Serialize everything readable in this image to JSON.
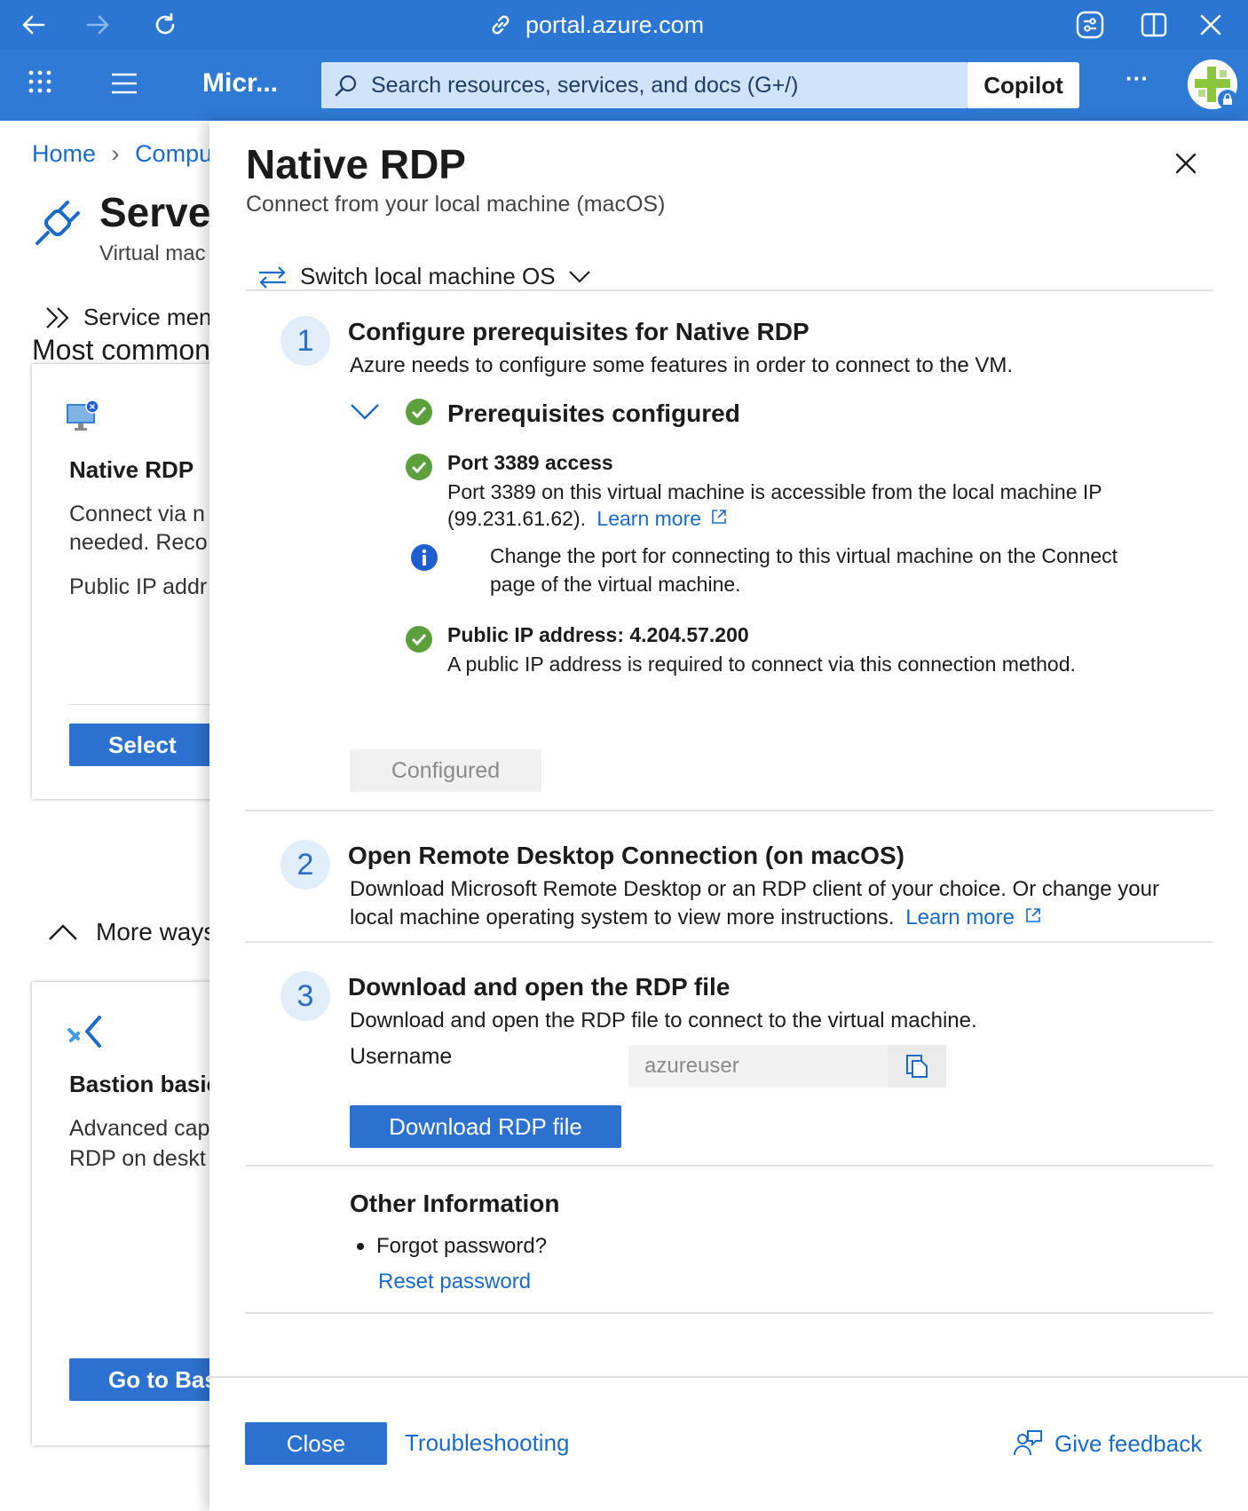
{
  "browser": {
    "url": "portal.azure.com"
  },
  "header": {
    "brand": "Micr...",
    "search_placeholder": "Search resources, services, and docs (G+/)",
    "copilot_label": "Copilot",
    "more_label": "···"
  },
  "background_page": {
    "breadcrumb_home": "Home",
    "breadcrumb_next": "Compu",
    "title": "Serve",
    "subtitle": "Virtual mac",
    "service_menu": "Service men",
    "section_heading": "Most common",
    "native_card": {
      "title": "Native RDP",
      "line1": "Connect via n",
      "line2": "needed. Reco",
      "line3": "Public IP addr",
      "button": "Select"
    },
    "more_ways": "More ways",
    "bastion_card": {
      "title": "Bastion basic",
      "line1": "Advanced cap",
      "line2": "RDP on deskt",
      "button": "Go to Bast"
    }
  },
  "panel": {
    "title": "Native RDP",
    "subtitle": "Connect from your local machine (macOS)",
    "switch_os": "Switch local machine OS",
    "step1": {
      "number": "1",
      "title": "Configure prerequisites for Native RDP",
      "description": "Azure needs to configure some features in order to connect to the VM.",
      "prereq_heading": "Prerequisites configured",
      "port": {
        "title": "Port 3389 access",
        "desc_line1": "Port 3389 on this virtual machine is accessible from the local machine IP",
        "desc_line2": "(99.231.61.62).",
        "learn_more": "Learn more"
      },
      "info_line1": "Change the port for connecting to this virtual machine on the Connect",
      "info_line2": "page of the virtual machine.",
      "public_ip": {
        "title": "Public IP address: 4.204.57.200",
        "desc": "A public IP address is required to connect via this connection method."
      },
      "configured_button": "Configured"
    },
    "step2": {
      "number": "2",
      "title": "Open Remote Desktop Connection (on macOS)",
      "desc_line1": "Download Microsoft Remote Desktop or an RDP client of your choice. Or change your",
      "desc_line2": "local machine operating system to view more instructions.",
      "learn_more": "Learn more"
    },
    "step3": {
      "number": "3",
      "title": "Download and open the RDP file",
      "description": "Download and open the RDP file to connect to the virtual machine.",
      "username_label": "Username",
      "username_value": "azureuser",
      "download_button": "Download RDP file"
    },
    "other_info": {
      "heading": "Other Information",
      "bullet": "Forgot password?",
      "reset_link": "Reset password"
    },
    "footer": {
      "close_button": "Close",
      "troubleshooting": "Troubleshooting",
      "feedback": "Give feedback"
    }
  },
  "colors": {
    "brand_blue": "#2f7ad5",
    "primary_button": "#2c71cf",
    "link": "#1a6bc9",
    "success_green": "#5ca03c",
    "info_blue": "#1f5ed0"
  }
}
